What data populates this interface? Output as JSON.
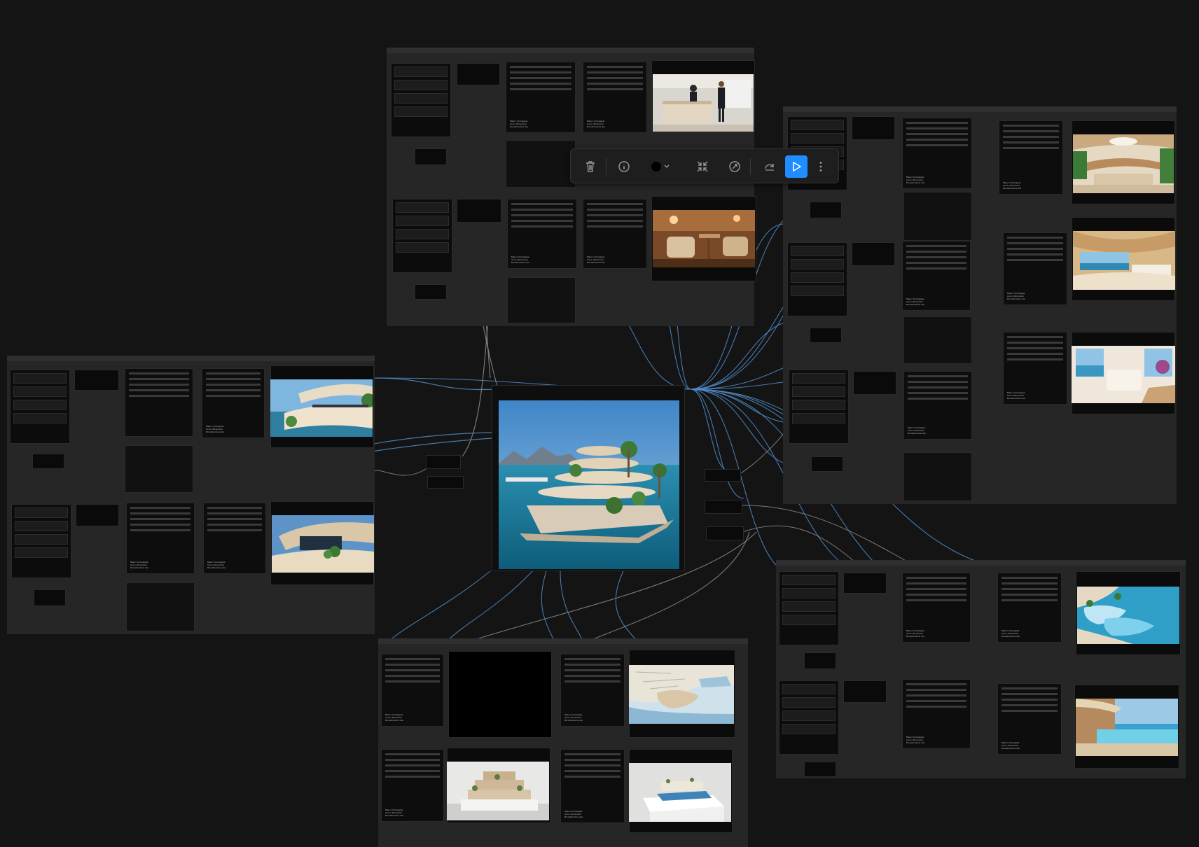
{
  "toolbar": {
    "delete_icon": "trash-icon",
    "info_icon": "info-icon",
    "color_icon": "color-swatch-icon",
    "color_value": "#000000",
    "collapse_icon": "collapse-arrows-icon",
    "bypass_icon": "bypass-icon",
    "convert_icon": "redo-arrow-icon",
    "run_icon": "play-icon",
    "more_icon": "more-vertical-icon",
    "accent": "#1f8dff"
  },
  "colors": {
    "canvas": "#141414",
    "group": "#262626",
    "node": "#0d0d0d",
    "wire_blue": "#4f8cc9",
    "wire_gray": "#8a8a8a"
  },
  "node_caption": "Mauro Immagine\nAnno dimension\nRicostruzione dei",
  "images": {
    "main": "island-resort-terraces",
    "top1": "hotel-reception",
    "top2": "restaurant-chairs",
    "left1": "curved-terrace-sea",
    "left2": "curved-balcony-plants",
    "right1": "atrium-lounge",
    "right2": "curved-bedroom-ocean",
    "right3": "bathroom-sea-view",
    "br1": "pool-terraces-aerial",
    "br2": "infinity-pool-room",
    "bottom1": "harbor-map",
    "bottom2": "architectural-model",
    "bottom3": "model-on-plinth"
  }
}
